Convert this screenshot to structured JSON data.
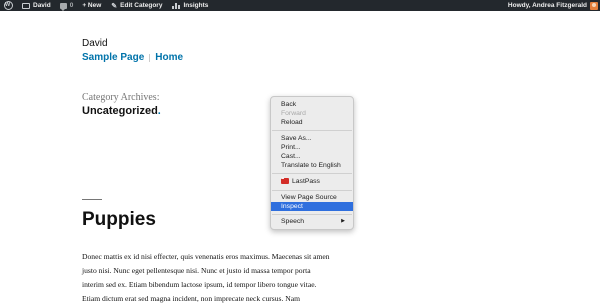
{
  "adminbar": {
    "site_name": "David",
    "comment_count": "0",
    "new_label": "+ New",
    "edit_category_label": "Edit Category",
    "insights_label": "Insights",
    "howdy": "Howdy, Andrea Fitzgerald",
    "colors": {
      "background": "#23282d",
      "text": "#eeeeee"
    }
  },
  "site": {
    "title": "David",
    "nav": [
      "Sample Page",
      "Home"
    ]
  },
  "archive": {
    "label": "Category Archives:",
    "title": "Uncategorized",
    "title_dot": "."
  },
  "post": {
    "title": "Puppies",
    "excerpt_lines": [
      "Donec mattis ex id nisi effecter, quis venenatis eros maximus. Maecenas sit amen",
      "justo nisi. Nunc eget pellentesque nisi. Nunc et justo id massa tempor porta",
      "interim sed ex. Etiam bibendum lactose ipsum, id tempor libero tongue vitae.",
      "Etiam dictum erat sed magna incident, non imprecate neck cursus. Nam"
    ]
  },
  "context_menu": {
    "items": {
      "back": "Back",
      "forward": "Forward",
      "reload": "Reload",
      "save_as": "Save As...",
      "print": "Print...",
      "cast": "Cast...",
      "translate": "Translate to English",
      "lastpass": "LastPass",
      "view_source": "View Page Source",
      "inspect": "Inspect",
      "speech": "Speech"
    },
    "disabled": [
      "Forward"
    ],
    "highlighted": "Inspect",
    "submenu_arrow": "▶",
    "colors": {
      "highlight": "#2f6fde",
      "background": "#ececec"
    }
  },
  "icons": [
    "wordpress-logo-icon",
    "home-icon",
    "comment-icon",
    "plus-icon",
    "pencil-icon",
    "insights-bars-icon",
    "avatar",
    "lastpass-icon",
    "submenu-arrow-icon"
  ]
}
